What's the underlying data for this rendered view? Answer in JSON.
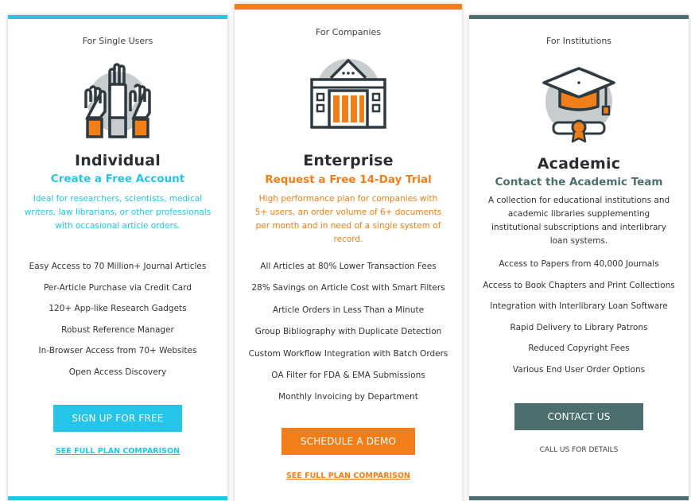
{
  "colors": {
    "individual_accent": "#24c5e8",
    "enterprise_accent": "#f07f1a",
    "academic_accent": "#4d6e6e"
  },
  "individual": {
    "audience": "For Single Users",
    "icon": "raised-hands-icon",
    "name": "Individual",
    "subtitle": "Create a Free Account",
    "description": "Ideal for researchers, scientists, medical writers, law librarians, or other professionals with occasional article orders.",
    "features": [
      "Easy Access to 70 Million+ Journal Articles",
      "Per-Article Purchase via Credit Card",
      "120+ App-like Research Gadgets",
      "Robust Reference Manager",
      "In-Browser Access from 70+ Websites",
      "Open Access Discovery"
    ],
    "cta_label": "SIGN UP FOR FREE",
    "link_label": "SEE FULL PLAN COMPARISON"
  },
  "enterprise": {
    "audience": "For Companies",
    "icon": "office-building-icon",
    "name": "Enterprise",
    "subtitle": "Request a Free 14-Day Trial",
    "description": "High performance plan for companies with 5+ users, an order volume of 6+ documents per month and in need of a single system of record.",
    "features": [
      "All Articles at 80% Lower Transaction Fees",
      "28% Savings on Article Cost with Smart Filters",
      "Article Orders in Less Than a Minute",
      "Group Bibliography with Duplicate Detection",
      "Custom Workflow Integration with Batch Orders",
      "OA Filter for FDA & EMA Submissions",
      "Monthly Invoicing by Department"
    ],
    "cta_label": "SCHEDULE A DEMO",
    "link_label": "SEE FULL PLAN COMPARISON"
  },
  "academic": {
    "audience": "For Institutions",
    "icon": "graduation-cap-icon",
    "name": "Academic",
    "subtitle": "Contact the Academic Team",
    "description": "A collection for educational institutions and academic libraries supplementing institutional subscriptions and interlibrary loan systems.",
    "features": [
      "Access to Papers from 40,000 Journals",
      "Access to Book Chapters and Print Collections",
      "Integration with Interlibrary Loan Software",
      "Rapid Delivery to Library Patrons",
      "Reduced Copyright Fees",
      "Various End User Order Options"
    ],
    "cta_label": "CONTACT US",
    "call_label": "CALL US FOR DETAILS"
  }
}
